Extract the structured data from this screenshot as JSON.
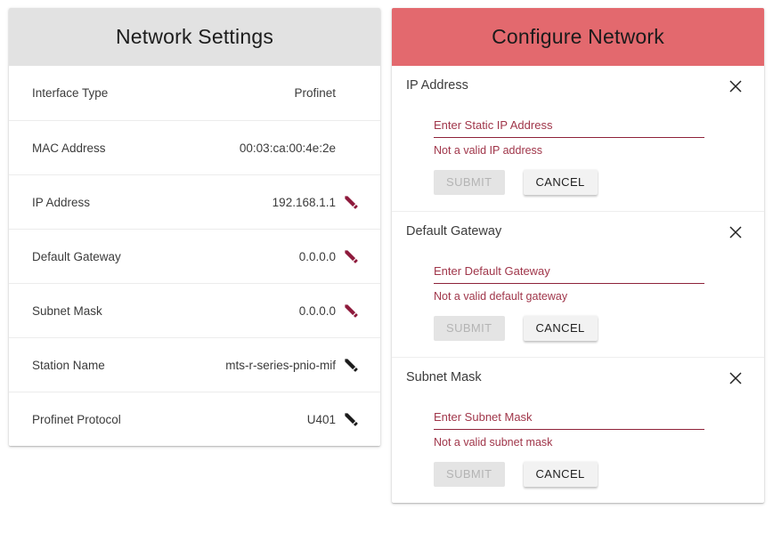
{
  "settings_panel": {
    "title": "Network Settings",
    "rows": [
      {
        "label": "Interface Type",
        "value": "Profinet",
        "icon": "none"
      },
      {
        "label": "MAC Address",
        "value": "00:03:ca:00:4e:2e",
        "icon": "none"
      },
      {
        "label": "IP Address",
        "value": "192.168.1.1",
        "icon": "pencil-icon-maroon"
      },
      {
        "label": "Default Gateway",
        "value": "0.0.0.0",
        "icon": "pencil-icon-maroon"
      },
      {
        "label": "Subnet Mask",
        "value": "0.0.0.0",
        "icon": "pencil-icon-maroon"
      },
      {
        "label": "Station Name",
        "value": "mts-r-series-pnio-mif",
        "icon": "pencil-icon-black"
      },
      {
        "label": "Profinet Protocol",
        "value": "U401",
        "icon": "pencil-icon-black"
      }
    ]
  },
  "configure_panel": {
    "title": "Configure Network",
    "close_icon": "close-icon",
    "sections": [
      {
        "title": "IP Address",
        "field_label": "Enter Static IP Address",
        "field_value": "",
        "error": "Not a valid IP address",
        "submit_label": "SUBMIT",
        "cancel_label": "CANCEL"
      },
      {
        "title": "Default Gateway",
        "field_label": "Enter Default Gateway",
        "field_value": "",
        "error": "Not a valid default gateway",
        "submit_label": "SUBMIT",
        "cancel_label": "CANCEL"
      },
      {
        "title": "Subnet Mask",
        "field_label": "Enter Subnet Mask",
        "field_value": "",
        "error": "Not a valid subnet mask",
        "submit_label": "SUBMIT",
        "cancel_label": "CANCEL"
      }
    ]
  },
  "colors": {
    "settings_header_bg": "#e2e2e2",
    "configure_header_bg": "#e3696e",
    "pencil_maroon": "#8e1a3c",
    "pencil_black": "#1c1c1c",
    "field_accent": "#8e2239",
    "error_text": "#a0364a"
  }
}
